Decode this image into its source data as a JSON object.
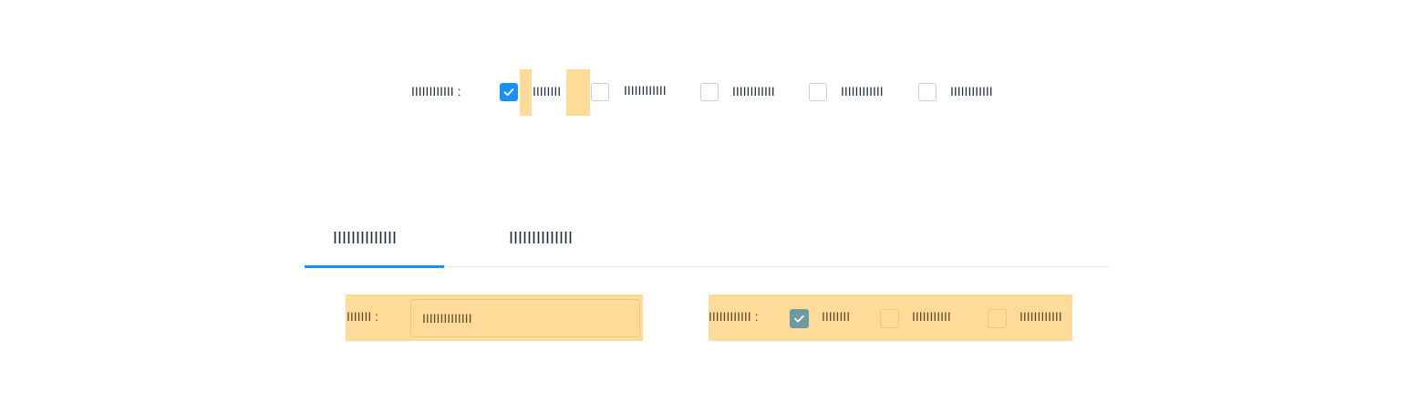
{
  "top_group": {
    "label": "IIIIIIIIIIII :",
    "options": [
      {
        "label": "IIIIIIII",
        "checked": true
      },
      {
        "label": "IIIIIIIIIIII",
        "checked": false
      },
      {
        "label": "IIIIIIIIIIII",
        "checked": false
      },
      {
        "label": "IIIIIIIIIIII",
        "checked": false
      },
      {
        "label": "IIIIIIIIIIII",
        "checked": false
      }
    ]
  },
  "tabs": [
    {
      "label": "IIIIIIIIIIIIII",
      "active": true
    },
    {
      "label": "IIIIIIIIIIIIII",
      "active": false
    }
  ],
  "form": {
    "field_label": "IIIIIII :",
    "field_value": "IIIIIIIIIIIIII",
    "group_label": "IIIIIIIIIIII :",
    "options": [
      {
        "label": "IIIIIIII",
        "checked": true
      },
      {
        "label": "IIIIIIIIIII",
        "checked": false
      },
      {
        "label": "IIIIIIIIIIII",
        "checked": false
      }
    ]
  },
  "colors": {
    "accent": "#1890ff",
    "highlight": "#ffdb99",
    "checked_disabled": "#6f9aa1"
  }
}
